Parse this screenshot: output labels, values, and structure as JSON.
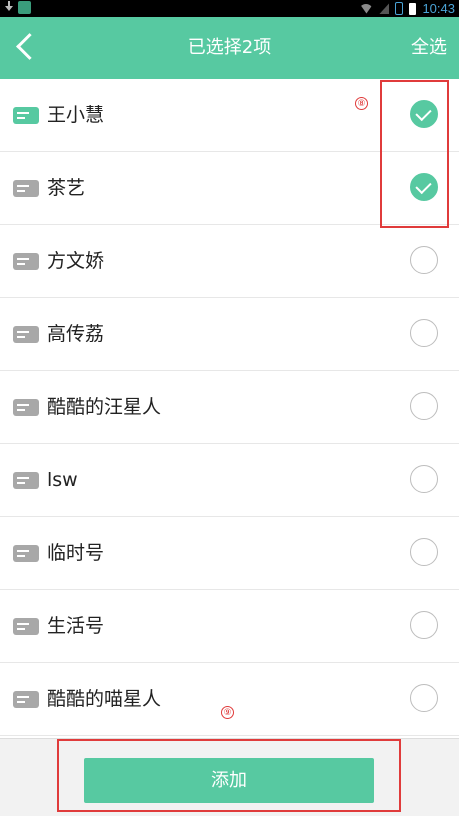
{
  "status_bar": {
    "time": "10:43"
  },
  "header": {
    "back_icon": "chevron-left-icon",
    "title": "已选择2项",
    "select_all": "全选"
  },
  "contacts": [
    {
      "name": "王小慧",
      "selected": true
    },
    {
      "name": "茶艺",
      "selected": true
    },
    {
      "name": "方文娇",
      "selected": false
    },
    {
      "name": "高传荔",
      "selected": false
    },
    {
      "name": "酷酷的汪星人",
      "selected": false
    },
    {
      "name": "lsw",
      "selected": false
    },
    {
      "name": "临时号",
      "selected": false
    },
    {
      "name": "生活号",
      "selected": false
    },
    {
      "name": "酷酷的喵星人",
      "selected": false
    }
  ],
  "annotations": {
    "a": "⑧",
    "b": "⑨"
  },
  "footer": {
    "add_label": "添加"
  },
  "colors": {
    "accent": "#57c9a1",
    "annotation": "#e03b3b"
  }
}
